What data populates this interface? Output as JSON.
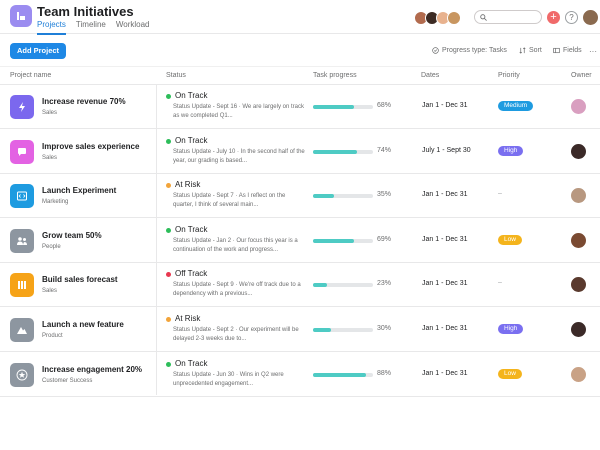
{
  "header": {
    "title": "Team Initiatives",
    "tabs": [
      {
        "label": "Projects",
        "active": true
      },
      {
        "label": "Timeline",
        "active": false
      },
      {
        "label": "Workload",
        "active": false
      }
    ],
    "avatar_colors": [
      "#b26b4e",
      "#3d2b24",
      "#e8b28e",
      "#c89660"
    ],
    "me_avatar_color": "#8a6a4f",
    "plus_label": "+",
    "help_label": "?"
  },
  "toolbar": {
    "add_label": "Add Project",
    "progress_type": "Progress type: Tasks",
    "sort_label": "Sort",
    "fields_label": "Fields",
    "more_label": "···"
  },
  "columns": {
    "name": "Project name",
    "status": "Status",
    "progress": "Task progress",
    "dates": "Dates",
    "priority": "Priority",
    "owner": "Owner"
  },
  "rows": [
    {
      "name": "Increase revenue 70%",
      "team": "Sales",
      "icon": "lightning-icon",
      "icon_color": "#7b68ee",
      "status": "On Track",
      "status_color": "#2dbd5a",
      "desc": "Status Update - Sept 16 · We are largely on track as we completed Q1...",
      "progress": 68,
      "progress_label": "68%",
      "dates": "Jan 1 - Dec 31",
      "priority": "Medium",
      "priority_color": "#1e9be0",
      "owner_color": "#d99fc0"
    },
    {
      "name": "Improve sales experience",
      "team": "Sales",
      "icon": "chat-icon",
      "icon_color": "#e362e3",
      "status": "On Track",
      "status_color": "#2dbd5a",
      "desc": "Status Update - July 10 · In the second half of the year, our grading is based...",
      "progress": 74,
      "progress_label": "74%",
      "dates": "July 1 - Sept 30",
      "priority": "High",
      "priority_color": "#7a6ff0",
      "owner_color": "#3b2a28"
    },
    {
      "name": "Launch Experiment",
      "team": "Marketing",
      "icon": "code-icon",
      "icon_color": "#1e9be0",
      "status": "At Risk",
      "status_color": "#f2a43a",
      "desc": "Status Update - Sept 7 · As I reflect on the quarter, I think of several main...",
      "progress": 35,
      "progress_label": "35%",
      "dates": "Jan 1 - Dec 31",
      "priority": "",
      "priority_empty": "–",
      "priority_color": "",
      "owner_color": "#b89880"
    },
    {
      "name": "Grow team 50%",
      "team": "People",
      "icon": "people-icon",
      "icon_color": "#8d96a0",
      "status": "On Track",
      "status_color": "#2dbd5a",
      "desc": "Status Update - Jan 2 · Our focus this year is a continuation of the work and progress...",
      "progress": 69,
      "progress_label": "69%",
      "dates": "Jan 1 - Dec 31",
      "priority": "Low",
      "priority_color": "#f4b41c",
      "owner_color": "#7a4a32"
    },
    {
      "name": "Build sales forecast",
      "team": "Sales",
      "icon": "columns-icon",
      "icon_color": "#f6a318",
      "status": "Off Track",
      "status_color": "#e8384f",
      "desc": "Status Update - Sept 9 · We're off track due to a dependency with a previous...",
      "progress": 23,
      "progress_label": "23%",
      "dates": "Jan 1 - Dec 31",
      "priority": "",
      "priority_empty": "–",
      "priority_color": "",
      "owner_color": "#5a3a2e"
    },
    {
      "name": "Launch a new feature",
      "team": "Product",
      "icon": "mountain-icon",
      "icon_color": "#8d96a0",
      "status": "At Risk",
      "status_color": "#f2a43a",
      "desc": "Status Update - Sept 2 · Our experiment will be delayed 2-3 weeks due to...",
      "progress": 30,
      "progress_label": "30%",
      "dates": "Jan 1 - Dec 31",
      "priority": "High",
      "priority_color": "#7a6ff0",
      "owner_color": "#3b2a28"
    },
    {
      "name": "Increase engagement 20%",
      "team": "Customer Success",
      "icon": "star-icon",
      "icon_color": "#8d96a0",
      "status": "On Track",
      "status_color": "#2dbd5a",
      "desc": "Status Update - Jun 30 · Wins in Q2 were unprecedented engagement...",
      "progress": 88,
      "progress_label": "88%",
      "dates": "Jan 1 - Dec 31",
      "priority": "Low",
      "priority_color": "#f4b41c",
      "owner_color": "#c9a286"
    }
  ]
}
